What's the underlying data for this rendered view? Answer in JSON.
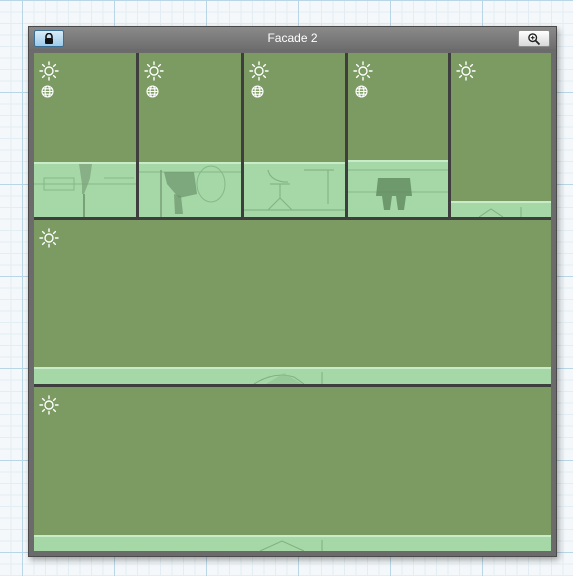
{
  "window": {
    "title": "Facade 2"
  },
  "toolbar": {
    "lock_icon": "lock-icon",
    "zoom_icon": "zoom-in-icon"
  },
  "panels": [
    {
      "id": "top-1",
      "icons": [
        "sun-icon",
        "globe-icon"
      ]
    },
    {
      "id": "top-2",
      "icons": [
        "sun-icon",
        "globe-icon"
      ]
    },
    {
      "id": "top-3",
      "icons": [
        "sun-icon",
        "globe-icon"
      ]
    },
    {
      "id": "top-4",
      "icons": [
        "sun-icon",
        "globe-icon"
      ]
    },
    {
      "id": "top-5",
      "icons": [
        "sun-icon"
      ]
    },
    {
      "id": "middle",
      "icons": [
        "sun-icon"
      ]
    },
    {
      "id": "bottom",
      "icons": [
        "sun-icon"
      ]
    }
  ],
  "colors": {
    "panel_fill": "#7b9b63",
    "sill_fill": "#a6d7a6",
    "frame": "#3e3e3e",
    "titlebar": "#7a7a7a",
    "lock_button": "#9ccbea"
  }
}
